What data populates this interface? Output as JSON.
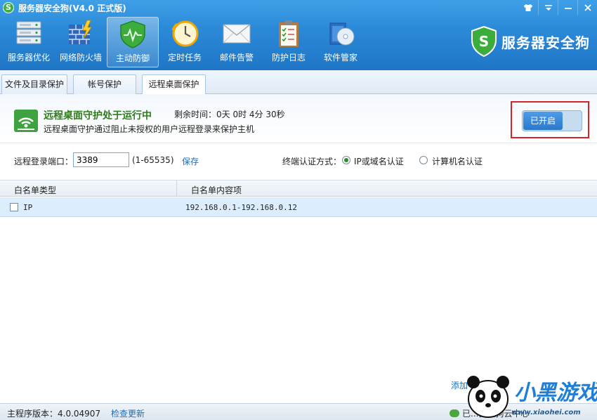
{
  "window": {
    "title": "服务器安全狗(V4.0 正式版)",
    "controls": [
      "skin-icon",
      "menu-icon",
      "minimize-icon",
      "close-icon"
    ]
  },
  "nav": {
    "items": [
      {
        "label": "服务器优化",
        "icon": "server-rack-icon",
        "active": false
      },
      {
        "label": "网络防火墙",
        "icon": "firewall-icon",
        "active": false
      },
      {
        "label": "主动防御",
        "icon": "shield-icon",
        "active": true
      },
      {
        "label": "定时任务",
        "icon": "clock-icon",
        "active": false
      },
      {
        "label": "邮件告警",
        "icon": "envelope-icon",
        "active": false
      },
      {
        "label": "防护日志",
        "icon": "clipboard-icon",
        "active": false
      },
      {
        "label": "软件管家",
        "icon": "software-box-icon",
        "active": false
      }
    ]
  },
  "brand": {
    "name": "服务器安全狗",
    "badge_letter": "S"
  },
  "tabs": [
    {
      "label": "文件及目录保护",
      "active": false
    },
    {
      "label": "帐号保护",
      "active": false
    },
    {
      "label": "远程桌面保护",
      "active": true
    }
  ],
  "status": {
    "title": "远程桌面守护处于运行中",
    "remaining_label": "剩余时间：",
    "remaining_value": "0天 0时 4分 30秒",
    "description": "远程桌面守护通过阻止未授权的用户远程登录来保护主机",
    "toggle_label": "已开启"
  },
  "port": {
    "label": "远程登录端口：",
    "value": "3389",
    "range": "(1-65535)",
    "save_label": "保存"
  },
  "auth": {
    "label": "终端认证方式：",
    "options": [
      {
        "label": "IP或域名认证",
        "checked": true
      },
      {
        "label": "计算机名认证",
        "checked": false
      }
    ]
  },
  "table": {
    "columns": [
      "白名单类型",
      "白名单内容项"
    ],
    "rows": [
      {
        "type": "IP",
        "content": "192.168.0.1-192.168.0.12",
        "checked": false
      }
    ]
  },
  "bottom_actions": {
    "add_label": "添加"
  },
  "footer": {
    "version_label": "主程序版本：4.0.04907",
    "check_update": "检查更新",
    "cloud_status": "已...安全狗云中心"
  },
  "watermark": {
    "text": "小黑游戏",
    "url": "www.xiaohei.com"
  }
}
